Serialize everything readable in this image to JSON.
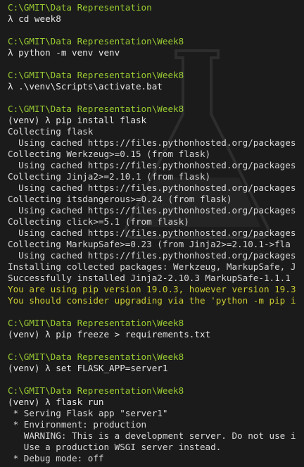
{
  "terminal": {
    "lines": [
      {
        "type": "path",
        "text": "C:\\GMIT\\Data Representation"
      },
      {
        "type": "prompt",
        "text": "λ cd week8"
      },
      {
        "type": "blank",
        "text": ""
      },
      {
        "type": "path",
        "text": "C:\\GMIT\\Data Representation\\Week8"
      },
      {
        "type": "prompt",
        "text": "λ python -m venv venv"
      },
      {
        "type": "blank",
        "text": ""
      },
      {
        "type": "path",
        "text": "C:\\GMIT\\Data Representation\\Week8"
      },
      {
        "type": "prompt",
        "text": "λ .\\venv\\Scripts\\activate.bat"
      },
      {
        "type": "blank",
        "text": ""
      },
      {
        "type": "path",
        "text": "C:\\GMIT\\Data Representation\\Week8"
      },
      {
        "type": "prompt",
        "text": "(venv) λ pip install flask"
      },
      {
        "type": "out",
        "text": "Collecting flask"
      },
      {
        "type": "out",
        "text": "  Using cached https://files.pythonhosted.org/packages"
      },
      {
        "type": "out",
        "text": "Collecting Werkzeug>=0.15 (from flask)"
      },
      {
        "type": "out",
        "text": "  Using cached https://files.pythonhosted.org/packages"
      },
      {
        "type": "out",
        "text": "Collecting Jinja2>=2.10.1 (from flask)"
      },
      {
        "type": "out",
        "text": "  Using cached https://files.pythonhosted.org/packages"
      },
      {
        "type": "out",
        "text": "Collecting itsdangerous>=0.24 (from flask)"
      },
      {
        "type": "out",
        "text": "  Using cached https://files.pythonhosted.org/packages"
      },
      {
        "type": "out",
        "text": "Collecting click>=5.1 (from flask)"
      },
      {
        "type": "out",
        "text": "  Using cached https://files.pythonhosted.org/packages"
      },
      {
        "type": "out",
        "text": "Collecting MarkupSafe>=0.23 (from Jinja2>=2.10.1->fla"
      },
      {
        "type": "out",
        "text": "  Using cached https://files.pythonhosted.org/packages"
      },
      {
        "type": "out",
        "text": "Installing collected packages: Werkzeug, MarkupSafe, J"
      },
      {
        "type": "out",
        "text": "Successfully installed Jinja2-2.10.3 MarkupSafe-1.1.1"
      },
      {
        "type": "warn",
        "text": "You are using pip version 19.0.3, however version 19.3"
      },
      {
        "type": "warn",
        "text": "You should consider upgrading via the 'python -m pip i"
      },
      {
        "type": "blank",
        "text": ""
      },
      {
        "type": "path",
        "text": "C:\\GMIT\\Data Representation\\Week8"
      },
      {
        "type": "prompt",
        "text": "(venv) λ pip freeze > requirements.txt"
      },
      {
        "type": "blank",
        "text": ""
      },
      {
        "type": "path",
        "text": "C:\\GMIT\\Data Representation\\Week8"
      },
      {
        "type": "prompt",
        "text": "(venv) λ set FLASK_APP=server1"
      },
      {
        "type": "blank",
        "text": ""
      },
      {
        "type": "path",
        "text": "C:\\GMIT\\Data Representation\\Week8"
      },
      {
        "type": "prompt",
        "text": "(venv) λ flask run"
      },
      {
        "type": "out",
        "text": " * Serving Flask app \"server1\""
      },
      {
        "type": "out",
        "text": " * Environment: production"
      },
      {
        "type": "out",
        "text": "   WARNING: This is a development server. Do not use i"
      },
      {
        "type": "out",
        "text": "   Use a production WSGI server instead."
      },
      {
        "type": "out",
        "text": " * Debug mode: off"
      }
    ]
  },
  "colors": {
    "background": "#1b1b1b",
    "path": "#9acd32",
    "warning": "#cccc33",
    "text": "#dcdcdc"
  }
}
